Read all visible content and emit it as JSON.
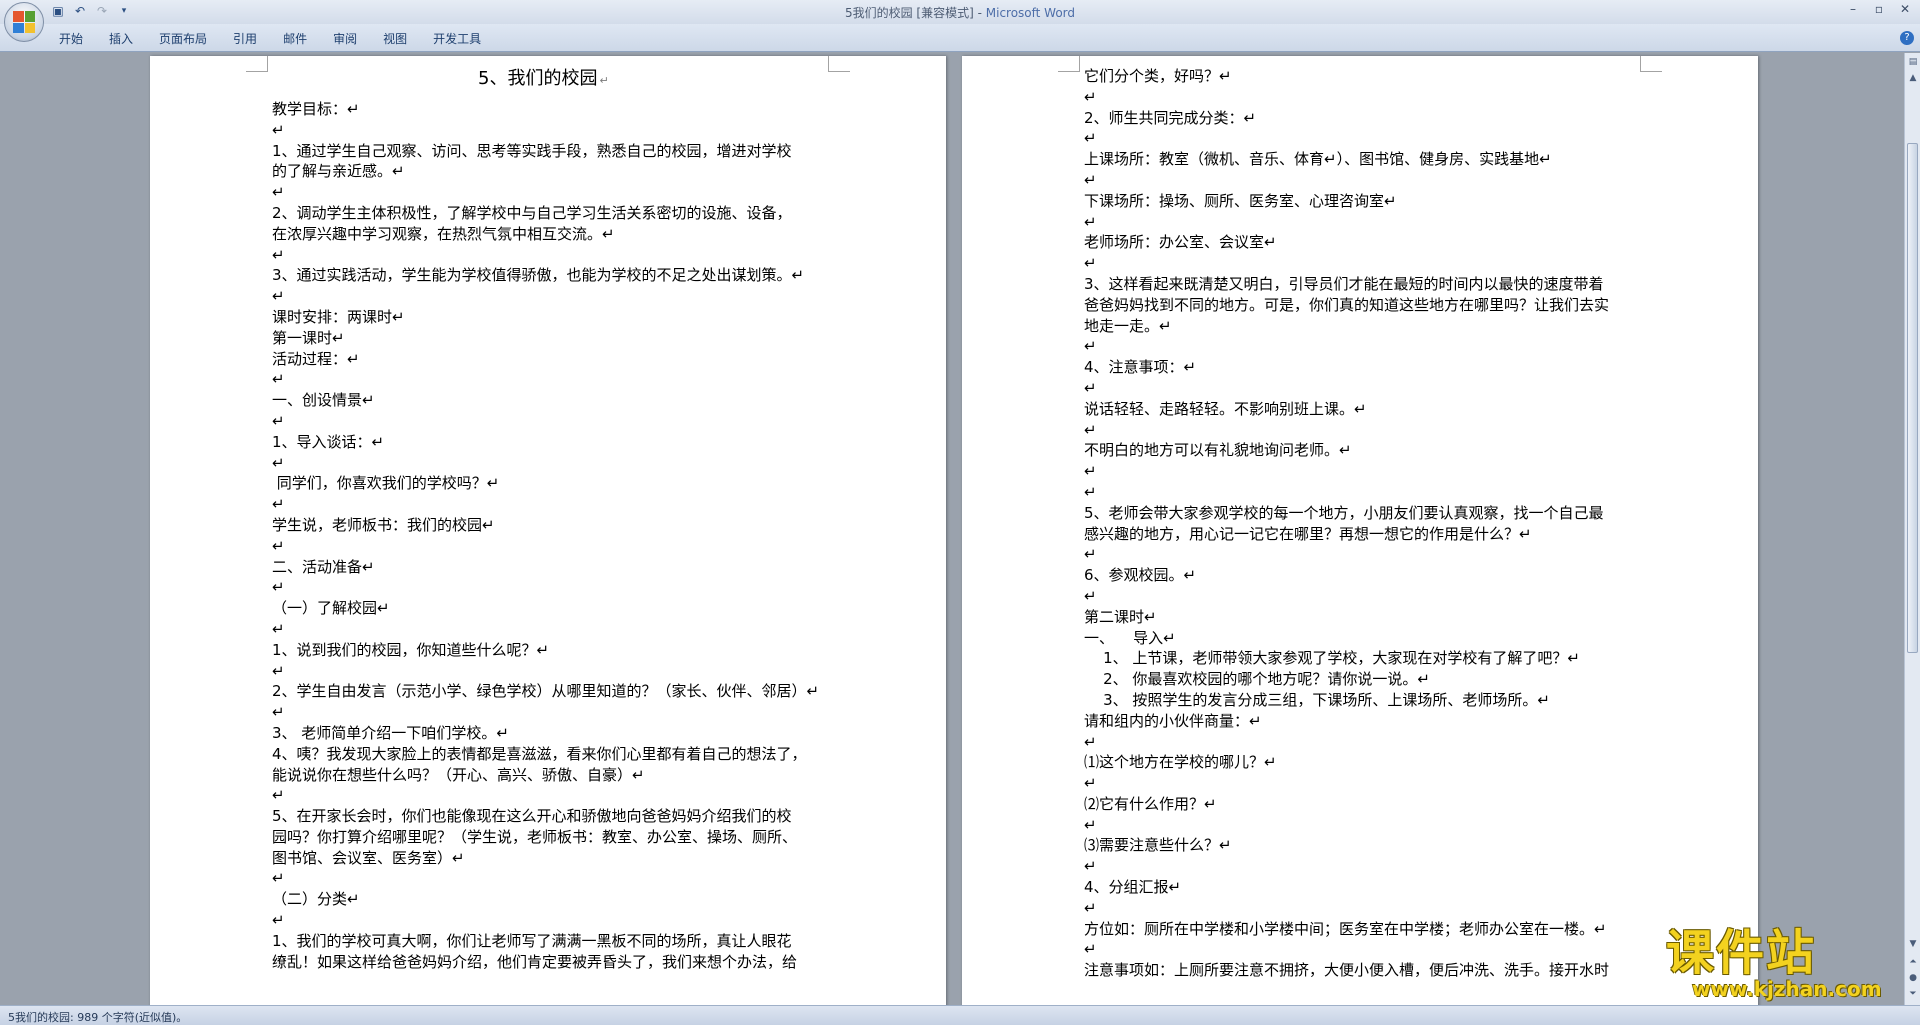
{
  "window": {
    "title_doc": "5我们的校园 [兼容模式]",
    "title_sep": " - ",
    "title_app": "Microsoft Word",
    "controls": [
      "–",
      "▫",
      "✕"
    ]
  },
  "qat": {
    "save_icon": "save-icon",
    "undo_icon": "undo-icon",
    "redo_icon": "redo-icon",
    "customize_icon": "customize-icon"
  },
  "tabs": [
    "开始",
    "插入",
    "页面布局",
    "引用",
    "邮件",
    "审阅",
    "视图",
    "开发工具"
  ],
  "help_label": "?",
  "left_page": {
    "title": "5、我们的校园",
    "body": "教学目标：↵\n↵\n1、通过学生自己观察、访问、思考等实践手段，熟悉自己的校园，增进对学校\n的了解与亲近感。↵\n↵\n2、调动学生主体积极性，了解学校中与自己学习生活关系密切的设施、设备，\n在浓厚兴趣中学习观察，在热烈气氛中相互交流。↵\n↵\n3、通过实践活动，学生能为学校值得骄傲，也能为学校的不足之处出谋划策。↵\n↵\n课时安排：两课时↵\n第一课时↵\n活动过程：↵\n↵\n一、创设情景↵\n↵\n1、导入谈话：↵\n↵\n 同学们，你喜欢我们的学校吗？↵\n↵\n学生说，老师板书：我们的校园↵\n↵\n二、活动准备↵\n↵\n（一）了解校园↵\n↵\n1、说到我们的校园，你知道些什么呢？↵\n↵\n2、学生自由发言（示范小学、绿色学校）从哪里知道的？（家长、伙伴、邻居）↵\n↵\n3、 老师简单介绍一下咱们学校。↵\n4、咦？我发现大家脸上的表情都是喜滋滋，看来你们心里都有着自己的想法了，\n能说说你在想些什么吗？（开心、高兴、骄傲、自豪）↵\n↵\n5、在开家长会时，你们也能像现在这么开心和骄傲地向爸爸妈妈介绍我们的校\n园吗？你打算介绍哪里呢？（学生说，老师板书：教室、办公室、操场、厕所、\n图书馆、会议室、医务室）↵\n↵\n（二）分类↵\n↵\n1、我们的学校可真大啊，你们让老师写了满满一黑板不同的场所，真让人眼花\n缭乱！如果这样给爸爸妈妈介绍，他们肯定要被弄昏头了，我们来想个办法，给"
  },
  "right_page": {
    "body": "它们分个类，好吗？↵\n↵\n2、师生共同完成分类：↵\n↵\n上课场所：教室（微机、音乐、体育↵）、图书馆、健身房、实践基地↵\n↵\n下课场所：操场、厕所、医务室、心理咨询室↵\n↵\n老师场所：办公室、会议室↵\n↵\n3、这样看起来既清楚又明白，引导员们才能在最短的时间内以最快的速度带着\n爸爸妈妈找到不同的地方。可是，你们真的知道这些地方在哪里吗？让我们去实\n地走一走。↵\n↵\n4、注意事项：↵\n↵\n说话轻轻、走路轻轻。不影响别班上课。↵\n↵\n不明白的地方可以有礼貌地询问老师。↵\n↵\n↵\n5、老师会带大家参观学校的每一个地方，小朋友们要认真观察，找一个自己最\n感兴趣的地方，用心记一记它在哪里？再想一想它的作用是什么？↵\n↵\n6、参观校园。↵\n↵\n第二课时↵\n一、    导入↵\n    1、 上节课，老师带领大家参观了学校，大家现在对学校有了解了吧？↵\n    2、 你最喜欢校园的哪个地方呢？请你说一说。↵\n    3、 按照学生的发言分成三组，下课场所、上课场所、老师场所。↵\n请和组内的小伙伴商量：↵\n↵\n⑴这个地方在学校的哪儿？↵\n↵\n⑵它有什么作用？↵\n↵\n⑶需要注意些什么？↵\n↵\n4、分组汇报↵\n↵\n方位如：厕所在中学楼和小学楼中间；医务室在中学楼；老师办公室在一楼。↵\n↵\n注意事项如：上厕所要注意不拥挤，大便小便入槽，便后冲洗、洗手。接开水时"
  },
  "status": {
    "text": "5我们的校园: 989 个字符(近似值)。"
  },
  "watermark": {
    "big": "课件站",
    "url": "www.kjzhan.com"
  },
  "colors": {
    "office_logo": [
      "#e4572e",
      "#58a032",
      "#2f7fd6",
      "#f2c12e"
    ],
    "watermark": "#f3d21f"
  }
}
